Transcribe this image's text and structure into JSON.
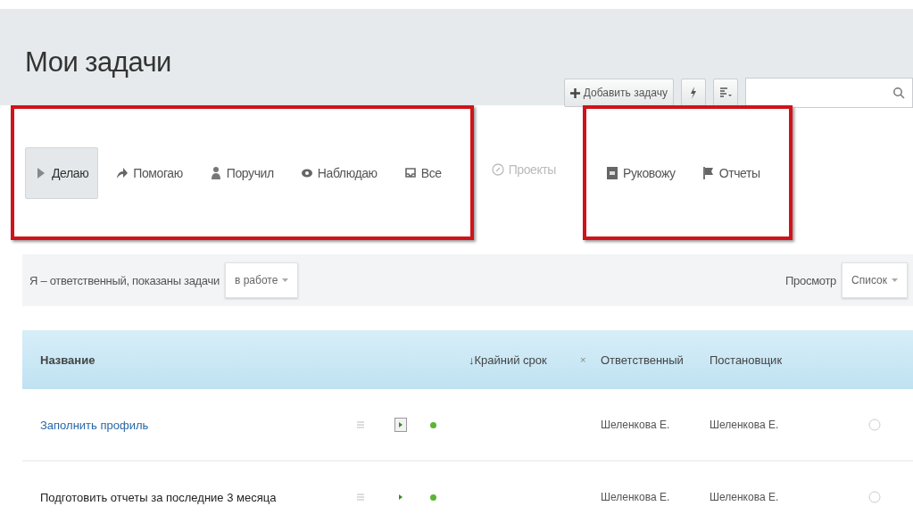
{
  "title": "Мои задачи",
  "toolbar": {
    "add_button": "Добавить задачу"
  },
  "tab_groups": [
    {
      "highlighted": true,
      "tabs": [
        {
          "label": "Делаю",
          "selected": true,
          "disabled": false
        },
        {
          "label": "Помогаю",
          "selected": false,
          "disabled": false
        },
        {
          "label": "Поручил",
          "selected": false,
          "disabled": false
        },
        {
          "label": "Наблюдаю",
          "selected": false,
          "disabled": false
        },
        {
          "label": "Все",
          "selected": false,
          "disabled": false
        }
      ]
    },
    {
      "highlighted": false,
      "tabs": [
        {
          "label": "Проекты",
          "selected": false,
          "disabled": true
        }
      ]
    },
    {
      "highlighted": true,
      "tabs": [
        {
          "label": "Руковожу",
          "selected": false,
          "disabled": false
        },
        {
          "label": "Отчеты",
          "selected": false,
          "disabled": false
        }
      ]
    }
  ],
  "filter": {
    "text": "Я – ответственный, показаны задачи",
    "status": "в работе",
    "view_label": "Просмотр",
    "view": "Список"
  },
  "table": {
    "columns": [
      "Название",
      "↓Крайний срок",
      "×",
      "Ответственный",
      "Постановщик"
    ],
    "rows": [
      {
        "title": "Заполнить профиль",
        "link": true,
        "play_framed": true,
        "responsible": "Шеленкова Е.",
        "creator": "Шеленкова Е."
      },
      {
        "title": "Подготовить отчеты за последние 3 месяца",
        "link": false,
        "play_framed": false,
        "responsible": "Шеленкова Е.",
        "creator": "Шеленкова Е."
      }
    ]
  }
}
